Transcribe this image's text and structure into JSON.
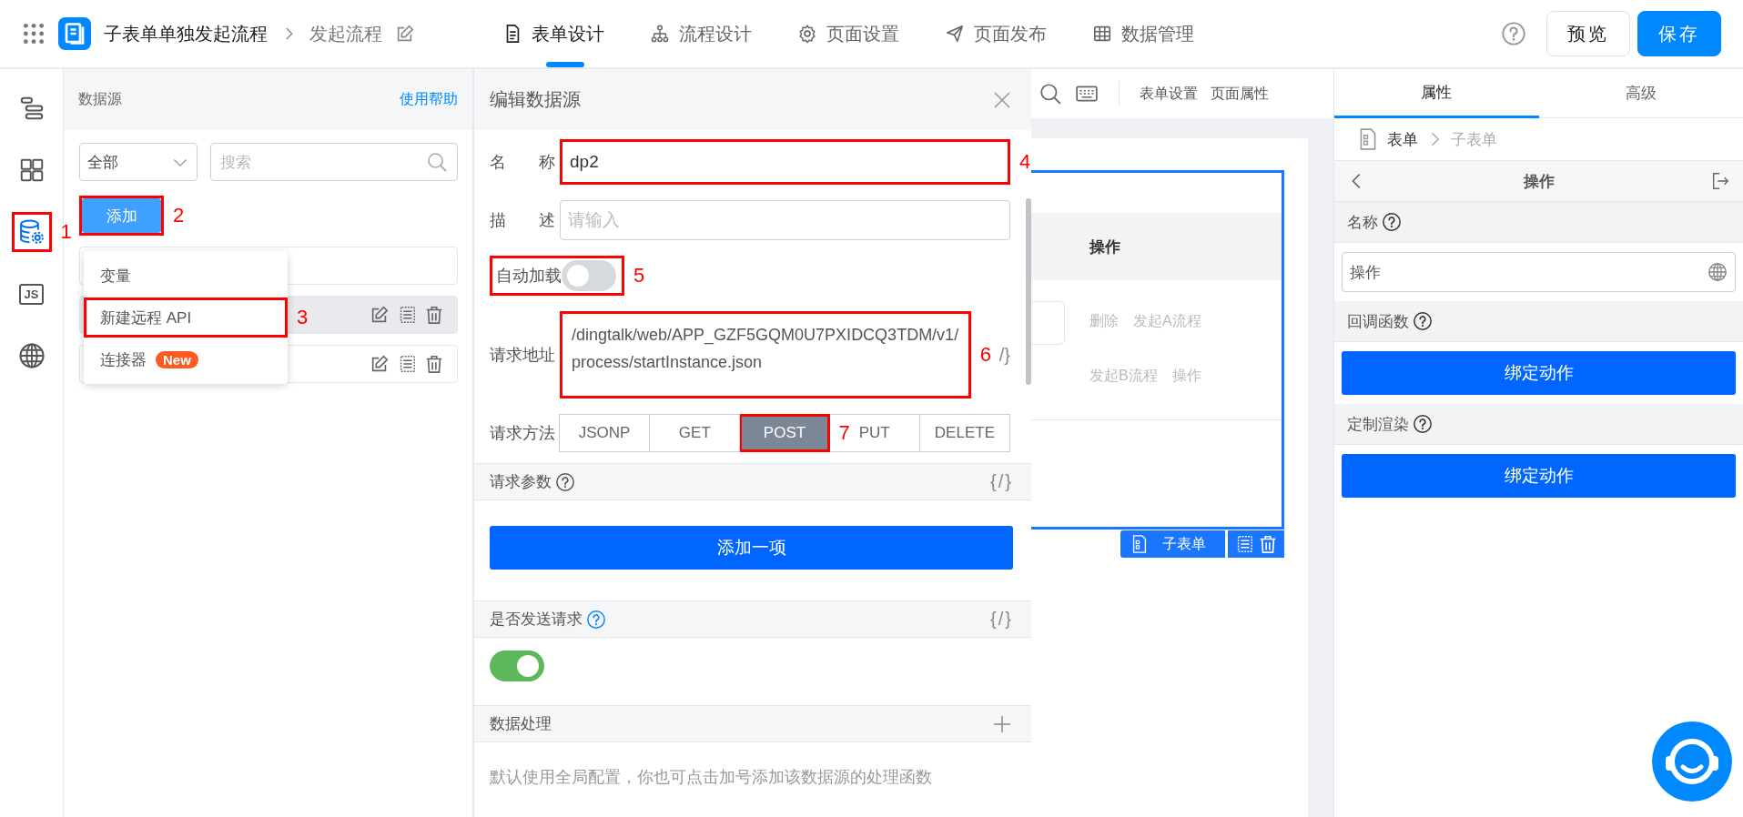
{
  "topbar": {
    "app_title": "子表单单独发起流程",
    "page_title": "发起流程",
    "nav": [
      {
        "label": "表单设计",
        "selected": true
      },
      {
        "label": "流程设计",
        "selected": false
      },
      {
        "label": "页面设置",
        "selected": false
      },
      {
        "label": "页面发布",
        "selected": false
      },
      {
        "label": "数据管理",
        "selected": false
      }
    ],
    "buttons": [
      {
        "label": "预览",
        "kind": "secondary"
      },
      {
        "label": "保存",
        "kind": "primary"
      }
    ]
  },
  "rail": [
    {
      "selected": false
    },
    {
      "selected": false
    },
    {
      "selected": true,
      "callout": "1"
    },
    {
      "label": "JS",
      "selected": false
    },
    {
      "selected": false
    }
  ],
  "datasource_panel": {
    "title": "数据源",
    "help_link": "使用帮助",
    "filter": {
      "value": "全部"
    },
    "search": {
      "placeholder": "搜索"
    },
    "add_button": {
      "label": "添加",
      "callout": "2"
    },
    "rows": [
      {
        "selected": false,
        "actions": false
      },
      {
        "selected": true,
        "actions": true
      },
      {
        "selected": false,
        "actions": true
      }
    ],
    "menu": [
      {
        "label": "变量"
      },
      {
        "label": "新建远程 API",
        "callout": "3"
      },
      {
        "label": "连接器",
        "badge": "New"
      }
    ]
  },
  "editor": {
    "title": "编辑数据源",
    "fields": [
      {
        "kind": "text",
        "label": "名称",
        "value": "dp2",
        "callout": "4"
      },
      {
        "kind": "text",
        "label": "描述",
        "placeholder": "请输入"
      },
      {
        "kind": "switch",
        "label": "自动加载",
        "on": false,
        "callout": "5"
      },
      {
        "kind": "textarea",
        "label": "请求地址",
        "value": "/dingtalk/web/APP_GZF5GQM0U7PXIDCQ3TDM/v1/process/startInstance.json",
        "callout": "6",
        "code": "/}"
      },
      {
        "kind": "segmented",
        "label": "请求方法",
        "options": [
          {
            "label": "JSONP",
            "selected": false
          },
          {
            "label": "GET",
            "selected": false
          },
          {
            "label": "POST",
            "selected": true,
            "callout": "7"
          },
          {
            "label": "PUT",
            "selected": false
          },
          {
            "label": "DELETE",
            "selected": false
          }
        ]
      }
    ],
    "sections": [
      {
        "title": "请求参数",
        "help_highlighted": false,
        "action": {
          "kind": "code",
          "text": "{/}"
        },
        "body": {
          "kind": "button",
          "label": "添加一项"
        }
      },
      {
        "title": "是否发送请求",
        "help_highlighted": true,
        "action": {
          "kind": "code",
          "text": "{/}"
        },
        "body": {
          "kind": "switch",
          "on": true
        }
      },
      {
        "title": "数据处理",
        "action": {
          "kind": "add"
        },
        "body": {
          "kind": "note",
          "text": "默认使用全局配置，你也可点击加号添加该数据源的处理函数"
        }
      }
    ]
  },
  "canvas": {
    "toolbar": [
      {
        "label": "表单设置"
      },
      {
        "label": "页面属性"
      }
    ],
    "table_header": "操作",
    "rows": [
      [
        "删除",
        "发起A流程"
      ],
      [
        "发起B流程",
        "操作"
      ]
    ],
    "tag": "子表单"
  },
  "props": {
    "tabs": [
      {
        "label": "属性",
        "selected": true
      },
      {
        "label": "高级",
        "selected": false
      }
    ],
    "breadcrumb": [
      {
        "label": "表单",
        "current": false
      },
      {
        "label": "子表单",
        "current": true
      }
    ],
    "title": "操作",
    "sections": [
      {
        "title": "名称",
        "body": {
          "kind": "input",
          "value": "操作"
        }
      },
      {
        "title": "回调函数",
        "body": {
          "kind": "button",
          "label": "绑定动作"
        }
      },
      {
        "title": "定制渲染",
        "body": {
          "kind": "button",
          "label": "绑定动作"
        }
      }
    ]
  }
}
